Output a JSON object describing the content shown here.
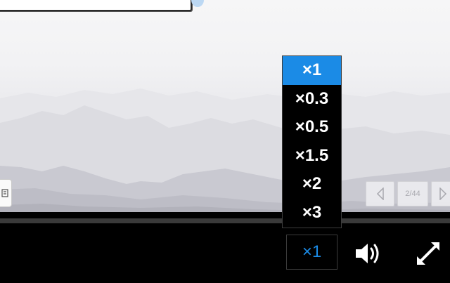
{
  "speed_menu": {
    "options": [
      "×1",
      "×0.3",
      "×0.5",
      "×1.5",
      "×2",
      "×3"
    ],
    "selected": "×1"
  },
  "controls": {
    "speed_label": "×1",
    "volume_icon": "speaker-icon",
    "fullscreen_icon": "expand-icon"
  },
  "slide_nav": {
    "counter": "2/44",
    "prev_icon": "triangle-left-icon",
    "next_icon": "triangle-right-icon"
  },
  "colors": {
    "accent": "#1b8be6",
    "background": "#000000"
  }
}
